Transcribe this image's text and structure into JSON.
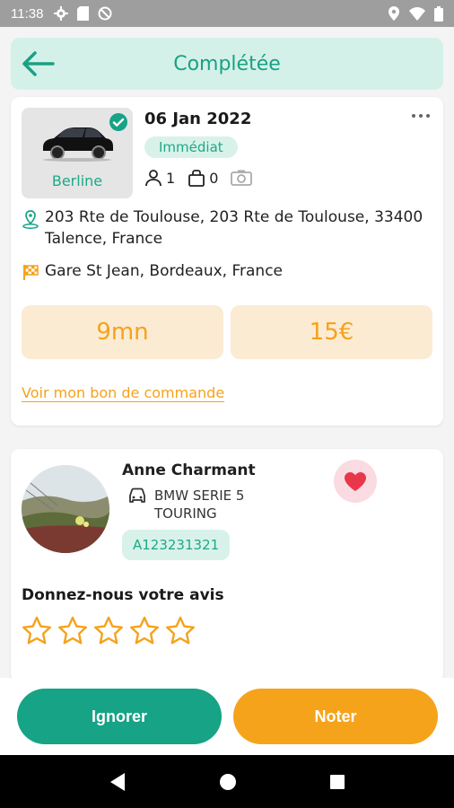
{
  "status_bar": {
    "time": "11:38",
    "left_icons": [
      "gear-icon",
      "sd-card-icon",
      "block-icon"
    ],
    "right_icons": [
      "location-icon",
      "wifi-icon",
      "battery-icon"
    ]
  },
  "header": {
    "back_icon": "arrow-left-icon",
    "title": "Complétée"
  },
  "trip": {
    "vehicle_type": "Berline",
    "date": "06 Jan 2022",
    "mode": "Immédiat",
    "passengers": "1",
    "luggage": "0",
    "pickup": "203 Rte de Toulouse, 203 Rte de Toulouse, 33400 Talence, France",
    "destination": "Gare St Jean, Bordeaux, France",
    "duration": "9mn",
    "price": "15€",
    "order_link": "Voir mon bon de commande"
  },
  "driver": {
    "name": "Anne Charmant",
    "vehicle_model": "BMW SERIE 5 TOURING",
    "plate": "A123231321",
    "review_prompt": "Donnez-nous votre avis",
    "rating": 0,
    "max_rating": 5
  },
  "actions": {
    "ignore_label": "Ignorer",
    "rate_label": "Noter"
  },
  "colors": {
    "accent_green": "#16a386",
    "accent_orange": "#f6a31c",
    "header_bg": "#d4f1e9",
    "pill_bg": "#fbebd3"
  }
}
